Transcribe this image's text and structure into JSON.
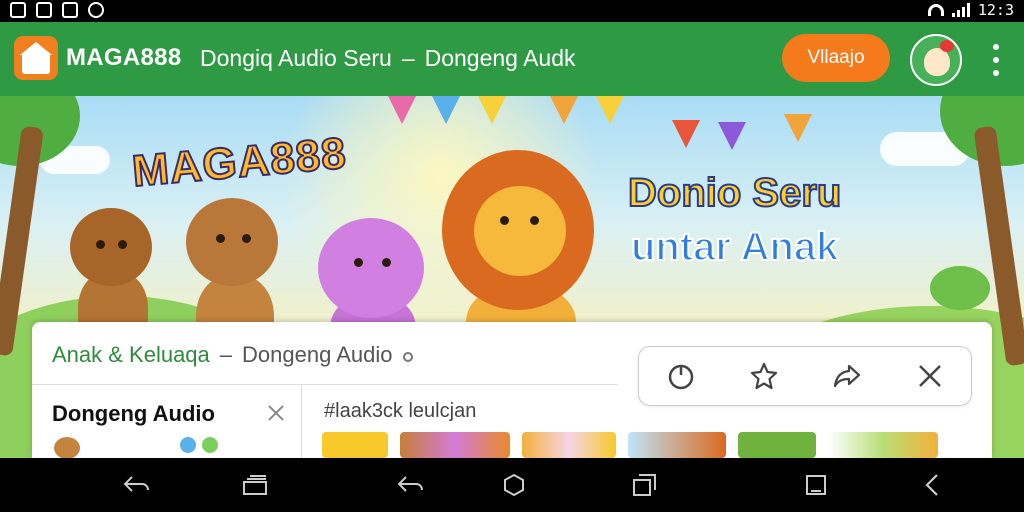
{
  "status_bar": {
    "left_icons": [
      "sim-icon",
      "image-icon",
      "shuffle-icon",
      "sync-icon"
    ],
    "time": "12:3"
  },
  "app_bar": {
    "brand": "MAGA888",
    "title_left": "Dongiq Audio Seru",
    "title_separator": "–",
    "title_right": "Dongeng Audk",
    "cta_label": "Vllaajo",
    "colors": {
      "bar": "#2f9a44",
      "cta": "#f47a1c",
      "logo": "#f07f1f"
    }
  },
  "banner": {
    "brand": "MAGA888",
    "headline_line1": "Donio Seru",
    "headline_line2": "untar Anak"
  },
  "panel": {
    "breadcrumb_primary": "Anak & Keluaqa",
    "breadcrumb_separator": "–",
    "breadcrumb_secondary": "Dongeng Audio",
    "sidebar_title": "Dongeng Audio",
    "hashtag": "#laak3ck leulcjan",
    "toolbar_icons": [
      "refresh-icon",
      "star-icon",
      "share-icon",
      "close-icon"
    ]
  },
  "nav_bar": {
    "icons": [
      "back-icon",
      "recents-stack-icon",
      "back-alt-icon",
      "home-icon",
      "overview-icon",
      "square-icon",
      "back-chevron-icon"
    ]
  }
}
